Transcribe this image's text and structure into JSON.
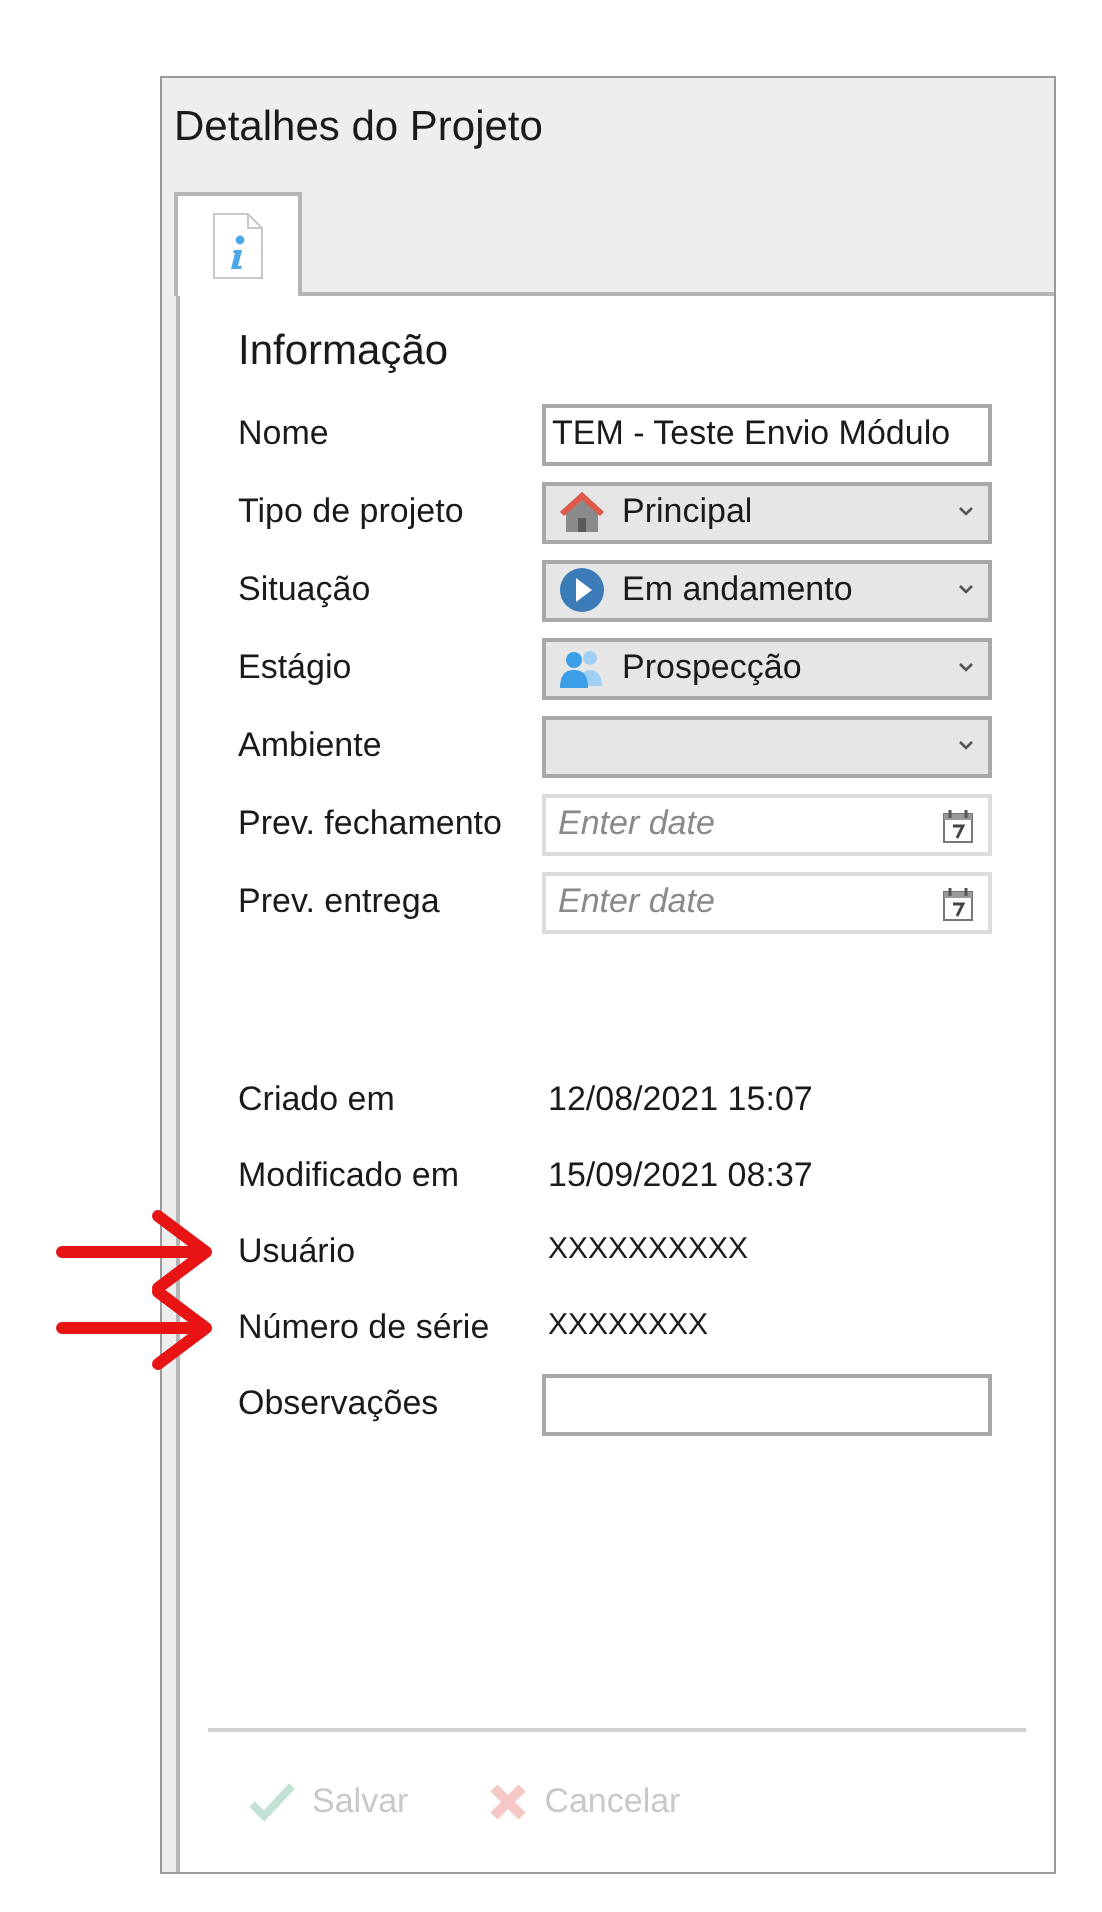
{
  "window": {
    "title": "Detalhes do Projeto"
  },
  "tabs": [
    {
      "selected": true
    }
  ],
  "section": {
    "title": "Informação"
  },
  "fields": [
    {
      "label": "Nome",
      "kind": "text",
      "value": "TEM - Teste Envio Módulo",
      "highlighted": false
    },
    {
      "label": "Tipo de projeto",
      "kind": "select",
      "value": "Principal",
      "highlighted": false
    },
    {
      "label": "Situação",
      "kind": "select",
      "value": "Em andamento",
      "highlighted": false
    },
    {
      "label": "Estágio",
      "kind": "select",
      "value": "Prospecção",
      "highlighted": false
    },
    {
      "label": "Ambiente",
      "kind": "select",
      "highlighted": false
    },
    {
      "label": "Prev. fechamento",
      "kind": "date",
      "placeholder": "Enter date",
      "highlighted": false
    },
    {
      "label": "Prev. entrega",
      "kind": "date",
      "placeholder": "Enter date",
      "highlighted": false
    },
    {
      "kind": "spacer"
    },
    {
      "label": "Criado em",
      "kind": "readonly",
      "value": "12/08/2021 15:07",
      "highlighted": false
    },
    {
      "label": "Modificado em",
      "kind": "readonly",
      "value": "15/09/2021 08:37",
      "highlighted": false
    },
    {
      "label": "Usuário",
      "kind": "readonly",
      "value": "XXXXXXXXXX",
      "highlighted": true
    },
    {
      "label": "Número de série",
      "kind": "readonly",
      "value": "XXXXXXXX",
      "highlighted": true
    },
    {
      "label": "Observações",
      "kind": "text",
      "highlighted": false
    }
  ],
  "buttons": [
    {
      "label": "Salvar",
      "disabled": true
    },
    {
      "label": "Cancelar",
      "disabled": true
    }
  ]
}
